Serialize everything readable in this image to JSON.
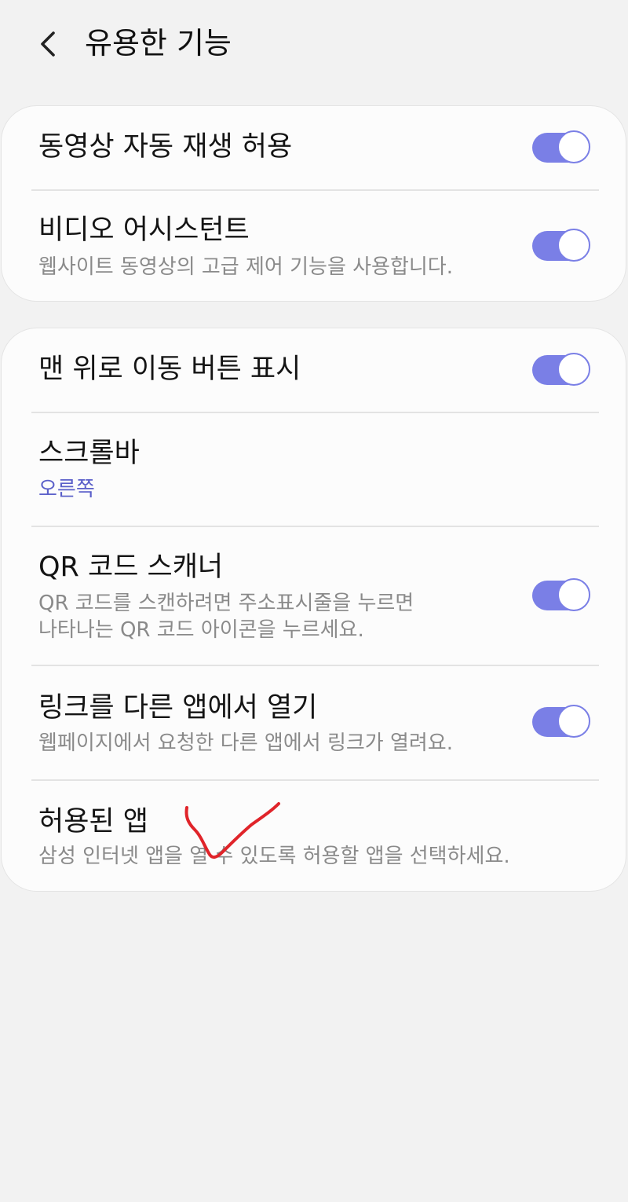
{
  "header": {
    "back_icon": "chevron-left-icon",
    "title": "유용한 기능"
  },
  "card1": {
    "items": [
      {
        "title": "동영상 자동 재생 허용",
        "toggle_on": true
      },
      {
        "title": "비디오 어시스턴트",
        "subtitle": "웹사이트 동영상의 고급 제어 기능을 사용합니다.",
        "toggle_on": true
      }
    ]
  },
  "card2": {
    "items": [
      {
        "title": "맨 위로 이동 버튼 표시",
        "toggle_on": true
      },
      {
        "title": "스크롤바",
        "subtitle": "오른쪽"
      },
      {
        "title": "QR 코드 스캐너",
        "subtitle_line1": "QR 코드를 스캔하려면 주소표시줄을 누르면",
        "subtitle_line2": "나타나는 QR 코드 아이콘을 누르세요.",
        "toggle_on": true
      },
      {
        "title": "링크를 다른 앱에서 열기",
        "subtitle": "웹페이지에서 요청한 다른 앱에서 링크가 열려요.",
        "toggle_on": true
      },
      {
        "title": "허용된 앱",
        "subtitle": "삼성 인터넷 앱을 열 수 있도록 허용할 앱을 선택하세요."
      }
    ]
  },
  "colors": {
    "toggle_on": "#7a7fe6",
    "accent_text": "#5a5fc9",
    "annotation": "#e0242a",
    "background": "#f2f2f2",
    "card": "#fcfcfc"
  }
}
